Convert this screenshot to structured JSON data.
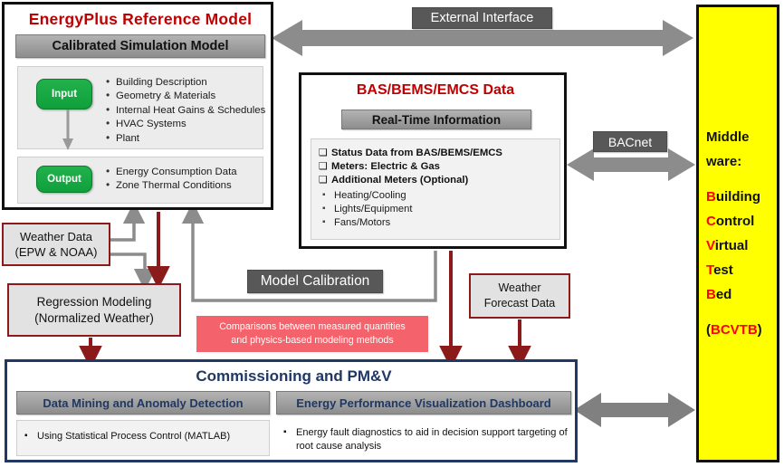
{
  "energyplus": {
    "title": "EnergyPlus Reference Model",
    "band_label": "Calibrated  Simulation  Model",
    "input_label": "Input",
    "output_label": "Output",
    "input_items": [
      "Building Description",
      "Geometry  &  Materials",
      "Internal Heat Gains & Schedules",
      "HVAC  Systems",
      "Plant"
    ],
    "output_items": [
      "Energy Consumption Data",
      "Zone Thermal Conditions"
    ]
  },
  "bas": {
    "title": "BAS/BEMS/EMCS Data",
    "band_label": "Real-Time Information",
    "checks": [
      "Status Data from BAS/BEMS/EMCS",
      "Meters: Electric  &  Gas",
      "Additional  Meters (Optional)"
    ],
    "subitems": [
      "Heating/Cooling",
      "Lights/Equipment",
      "Fans/Motors"
    ]
  },
  "middleware": {
    "line1": "Middle",
    "line2": "ware:",
    "expansion": [
      {
        "initial": "B",
        "rest": "uilding"
      },
      {
        "initial": "C",
        "rest": "ontrol"
      },
      {
        "initial": "V",
        "rest": "irtual"
      },
      {
        "initial": "T",
        "rest": "est"
      },
      {
        "initial": "B",
        "rest": "ed"
      }
    ],
    "acronym_open": "(",
    "acronym": "BCVTB",
    "acronym_close": ")"
  },
  "connectors": {
    "external_interface": "External Interface",
    "bacnet": "BACnet",
    "model_calibration": "Model Calibration"
  },
  "weather_data": {
    "line1": "Weather  Data",
    "line2": "(EPW & NOAA)"
  },
  "regression": {
    "line1": "Regression Modeling",
    "line2": "(Normalized Weather)"
  },
  "weather_forecast": {
    "line1": "Weather",
    "line2": "Forecast Data"
  },
  "comparison_note": {
    "line1": "Comparisons between  measured quantities",
    "line2": "and physics-based modeling methods"
  },
  "commissioning": {
    "title": "Commissioning and PM&V",
    "left_header": "Data Mining and Anomaly Detection",
    "right_header": "Energy Performance Visualization Dashboard",
    "left_items": [
      "Using Statistical Process Control (MATLAB)"
    ],
    "right_items": [
      "Energy fault diagnostics to aid in decision support targeting of root cause analysis"
    ]
  },
  "colors": {
    "accent_red": "#c00000",
    "middleware_yellow": "#ffff00",
    "middleware_red": "#ff0000",
    "commissioning_blue": "#1f3864",
    "box_border_red": "#8b1a1a",
    "arrow_gray": "#808080",
    "arrow_red": "#8b1a1a",
    "pink_note": "#f4636b",
    "green_io": "#22b14c"
  }
}
